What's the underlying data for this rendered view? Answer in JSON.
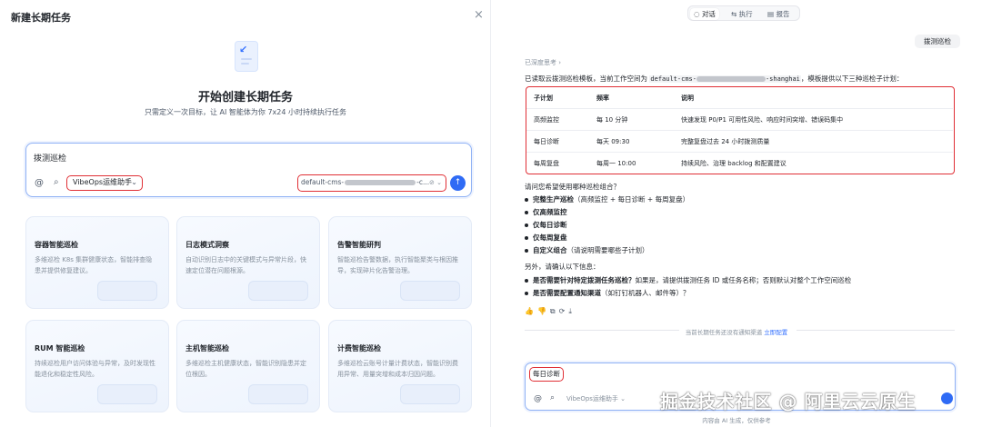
{
  "left": {
    "title": "新建长期任务",
    "close": "×",
    "hero_title": "开始创建长期任务",
    "hero_subtitle": "只需定义一次目标，让 AI 智能体为你 7x24 小时持续执行任务",
    "input_text": "拨测巡检",
    "agent_label": "VibeOps运维助手",
    "workspace_prefix": "default-cms-",
    "workspace_suffix": "-c...",
    "cards": [
      {
        "title": "容器智能巡检",
        "desc": "多维巡检 K8s 集群健康状态，智能排查隐患并提供修复建议。"
      },
      {
        "title": "日志模式洞察",
        "desc": "自动识别日志中的关键模式与异常片段，快速定位潜在问题根源。"
      },
      {
        "title": "告警智能研判",
        "desc": "智能巡检告警数据，执行智能聚类与根因推导，实现碎片化告警治理。"
      },
      {
        "title": "RUM 智能巡检",
        "desc": "持续巡检用户访问体验与异常，及时发现性能退化和稳定性风险。"
      },
      {
        "title": "主机智能巡检",
        "desc": "多维巡检主机健康状态，智能识别隐患并定位根因。"
      },
      {
        "title": "计费智能巡检",
        "desc": "多维巡检云账号计量计费状态，智能识别费用异常、用量突增和成本归因问题。"
      }
    ]
  },
  "right": {
    "tabs": [
      "对话",
      "执行",
      "报告"
    ],
    "user_message": "拨测巡检",
    "thinking": "已深度思考 ›",
    "intro_before": "已读取云拨测巡检模板，当前工作空间为",
    "intro_code_prefix": "default-cms-",
    "intro_code_suffix": "-shanghai",
    "intro_after": "，模板提供以下三种巡检子计划：",
    "table": {
      "headers": [
        "子计划",
        "频率",
        "说明"
      ],
      "rows": [
        [
          "高频监控",
          "每 10 分钟",
          "快速发现 P0/P1 可用性风险、响应时间突增、错误码集中"
        ],
        [
          "每日诊断",
          "每天 09:30",
          "完整复盘过去 24 小时拨测质量"
        ],
        [
          "每周复盘",
          "每周一 10:00",
          "持续风险、治理 backlog 和配置建议"
        ]
      ]
    },
    "question": "请问您希望使用哪种巡检组合？",
    "options": [
      {
        "bold": "完整生产巡检",
        "rest": "（高频监控 + 每日诊断 + 每周复盘）"
      },
      {
        "bold": "仅高频监控",
        "rest": ""
      },
      {
        "bold": "仅每日诊断",
        "rest": ""
      },
      {
        "bold": "仅每周复盘",
        "rest": ""
      },
      {
        "bold": "自定义组合",
        "rest": "（请说明需要哪些子计划）"
      }
    ],
    "also": "另外，请确认以下信息：",
    "confirms": [
      {
        "bold": "是否需要针对特定拨测任务巡检？",
        "rest": "如果是，请提供拨测任务 ID 或任务名称；否则默认对整个工作空间巡检"
      },
      {
        "bold": "是否需要配置通知渠道",
        "rest": "（如钉钉机器人、邮件等）？"
      }
    ],
    "action_icons": "👍👎⧉⟳⤓",
    "divider_text": "当前长期任务还没有通知渠道",
    "divider_link": "立即配置",
    "input_text": "每日诊断",
    "agent_label": "VibeOps运维助手 ⌄",
    "footnote": "内容由 AI 生成，仅供参考"
  },
  "watermark": "掘金技术社区 @ 阿里云云原生"
}
